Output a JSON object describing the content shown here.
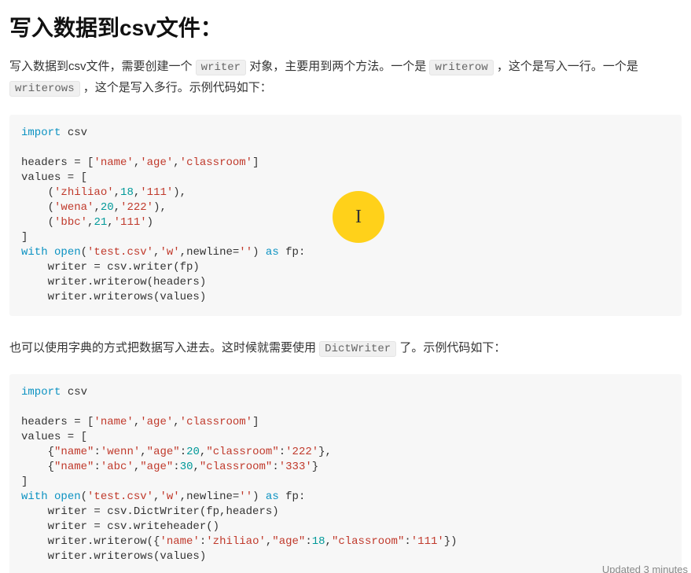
{
  "title": "写入数据到csv文件：",
  "para1": {
    "t0": "写入数据到csv文件，需要创建一个 ",
    "c0": "writer",
    "t1": " 对象，主要用到两个方法。一个是 ",
    "c1": "writerow",
    "t2": " ，这个是写入一行。一个是 ",
    "c2": "writerows",
    "t3": " ，这个是写入多行。示例代码如下："
  },
  "code1": "import csv\n\nheaders = ['name','age','classroom']\nvalues = [\n    ('zhiliao',18,'111'),\n    ('wena',20,'222'),\n    ('bbc',21,'111')\n]\nwith open('test.csv','w',newline='') as fp:\n    writer = csv.writer(fp)\n    writer.writerow(headers)\n    writer.writerows(values)",
  "para2": {
    "t0": "也可以使用字典的方式把数据写入进去。这时候就需要使用 ",
    "c0": "DictWriter",
    "t1": " 了。示例代码如下："
  },
  "code2": "import csv\n\nheaders = ['name','age','classroom']\nvalues = [\n    {\"name\":'wenn',\"age\":20,\"classroom\":'222'},\n    {\"name\":'abc',\"age\":30,\"classroom\":'333'}\n]\nwith open('test.csv','w',newline='') as fp:\n    writer = csv.DictWriter(fp,headers)\n    writer = csv.writeheader()\n    writer.writerow({'name':'zhiliao',\"age\":18,\"classroom\":'111'})\n    writer.writerows(values)",
  "cursor_glyph": "I",
  "status": "Updated 3 minutes "
}
